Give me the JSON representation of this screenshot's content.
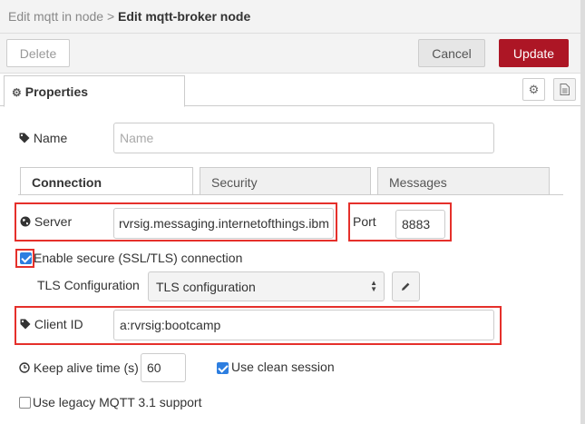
{
  "header": {
    "breadcrumb_parent": "Edit mqtt in node",
    "separator": ">",
    "breadcrumb_current": "Edit mqtt-broker node"
  },
  "toolbar": {
    "delete_label": "Delete",
    "cancel_label": "Cancel",
    "update_label": "Update"
  },
  "tabs": {
    "properties_label": "Properties"
  },
  "form": {
    "name_label": "Name",
    "name_placeholder": "Name",
    "name_value": "",
    "subtabs": [
      "Connection",
      "Security",
      "Messages"
    ],
    "server_label": "Server",
    "server_value": "rvrsig.messaging.internetofthings.ibm",
    "port_label": "Port",
    "port_value": "8883",
    "ssl_label": "Enable secure (SSL/TLS) connection",
    "ssl_checked": true,
    "tls_config_label": "TLS Configuration",
    "tls_config_value": "TLS configuration",
    "client_id_label": "Client ID",
    "client_id_value": "a:rvrsig:bootcamp",
    "keepalive_label": "Keep alive time (s)",
    "keepalive_value": "60",
    "clean_session_label": "Use clean session",
    "clean_session_checked": true,
    "legacy_label": "Use legacy MQTT 3.1 support",
    "legacy_checked": false
  },
  "colors": {
    "accent": "#ad1625",
    "highlight": "#e5302b",
    "checkbox": "#2d7ee0"
  }
}
